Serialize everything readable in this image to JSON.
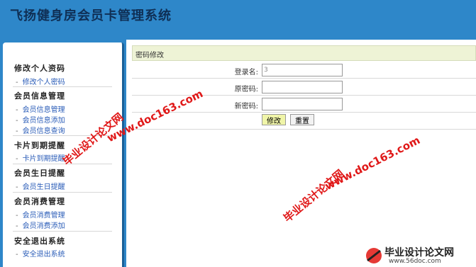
{
  "app": {
    "title": "飞扬健身房会员卡管理系统"
  },
  "sidebar": {
    "groups": [
      {
        "title": "修改个人资码",
        "links": [
          "修改个人密码"
        ]
      },
      {
        "title": "会员信息管理",
        "links": [
          "会员信息管理",
          "会员信息添加",
          "会员信息查询"
        ]
      },
      {
        "title": "卡片到期提醒",
        "links": [
          "卡片到期提醒"
        ]
      },
      {
        "title": "会员生日提醒",
        "links": [
          "会员生日提醒"
        ]
      },
      {
        "title": "会员消费管理",
        "links": [
          "会员消费管理",
          "会员消费添加"
        ]
      },
      {
        "title": "安全退出系统",
        "links": [
          "安全退出系统"
        ]
      }
    ],
    "dash": "-"
  },
  "panel": {
    "heading": "密码修改",
    "fields": {
      "username": {
        "label": "登录名:",
        "value": "3"
      },
      "old_password": {
        "label": "原密码:",
        "value": ""
      },
      "new_password": {
        "label": "新密码:",
        "value": ""
      }
    },
    "buttons": {
      "submit": "修改",
      "reset": "重置"
    }
  },
  "watermarks": {
    "site_cn": "毕业设计论文网",
    "url": "www.doc163.com",
    "logo_cn": "毕业设计论文网",
    "logo_url": "www.56doc.com"
  }
}
